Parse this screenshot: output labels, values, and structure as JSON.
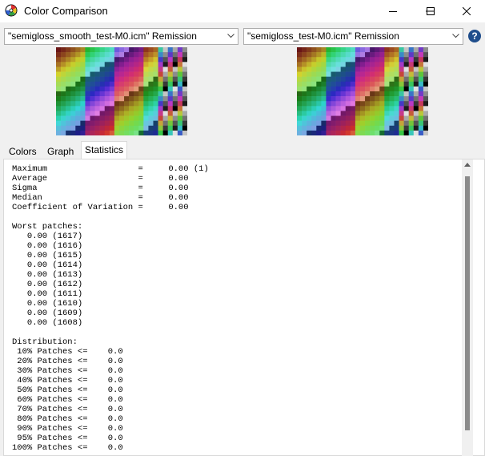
{
  "window": {
    "title": "Color Comparison"
  },
  "left_profile": {
    "value": "\"semigloss_smooth_test-M0.icm\" Remission"
  },
  "right_profile": {
    "value": "\"semigloss_test-M0.icm\" Remission"
  },
  "help_label": "?",
  "tabs": [
    {
      "label": "Colors"
    },
    {
      "label": "Graph"
    },
    {
      "label": "Statistics"
    }
  ],
  "statistics_text": "Maximum                  =     0.00 (1)\nAverage                  =     0.00\nSigma                    =     0.00\nMedian                   =     0.00\nCoefficient of Variation =     0.00\n\nWorst patches:\n   0.00 (1617)\n   0.00 (1616)\n   0.00 (1615)\n   0.00 (1614)\n   0.00 (1613)\n   0.00 (1612)\n   0.00 (1611)\n   0.00 (1610)\n   0.00 (1609)\n   0.00 (1608)\n\nDistribution:\n 10% Patches <=    0.0\n 20% Patches <=    0.0\n 30% Patches <=    0.0\n 40% Patches <=    0.0\n 50% Patches <=    0.0\n 60% Patches <=    0.0\n 70% Patches <=    0.0\n 80% Patches <=    0.0\n 90% Patches <=    0.0\n 95% Patches <=    0.0\n100% Patches <=    0.0",
  "icons": {
    "app": "color-wheel-icon",
    "minimize": "minimize-icon",
    "maximize": "maximize-icon",
    "close": "close-icon",
    "dropdown": "chevron-down-icon",
    "help": "help-icon"
  },
  "colors": {
    "titlebar": "#ffffff",
    "window_bg": "#f0f0f0",
    "panel_bg": "#ffffff",
    "help_accent": "#1f4e8c",
    "scroll_thumb": "#8b8b8b"
  }
}
